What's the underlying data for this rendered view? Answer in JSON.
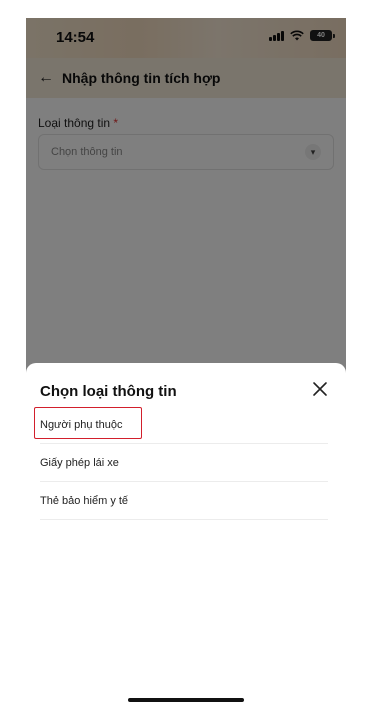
{
  "status_bar": {
    "time": "14:54",
    "battery": "40"
  },
  "header": {
    "back_icon": "arrow-left-icon",
    "title": "Nhập thông tin tích hợp"
  },
  "form": {
    "field_label": "Loại thông tin",
    "required_mark": "*",
    "select_placeholder": "Chọn thông tin"
  },
  "sheet": {
    "title": "Chọn loại thông tin",
    "options": [
      {
        "label": "Người phụ thuộc"
      },
      {
        "label": "Giấy phép lái xe"
      },
      {
        "label": "Thẻ bảo hiểm y tế"
      }
    ]
  },
  "colors": {
    "highlight": "#d21f2c",
    "required": "#e03131"
  }
}
